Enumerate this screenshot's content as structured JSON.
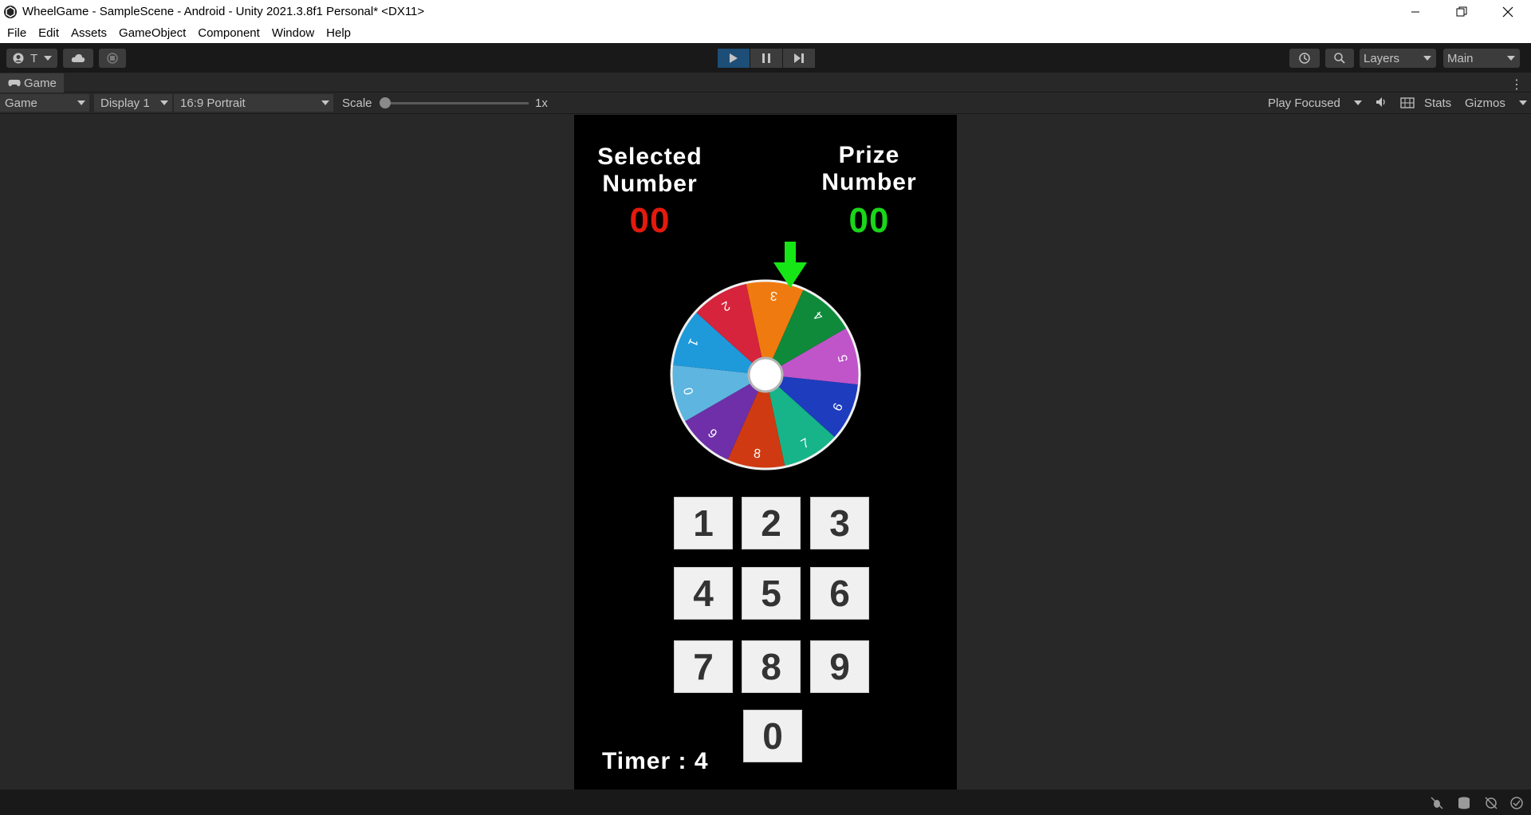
{
  "window": {
    "title": "WheelGame - SampleScene - Android - Unity 2021.3.8f1 Personal* <DX11>",
    "controls": [
      "minimize-icon",
      "restore-icon",
      "close-icon"
    ]
  },
  "menu": {
    "items": [
      "File",
      "Edit",
      "Assets",
      "GameObject",
      "Component",
      "Window",
      "Help"
    ]
  },
  "toolbar": {
    "account_label": "T",
    "layers_label": "Layers",
    "layout_label": "Main"
  },
  "tab": {
    "label": "Game"
  },
  "gamebar": {
    "mode": "Game",
    "display": "Display 1",
    "aspect": "16:9 Portrait",
    "scale_label": "Scale",
    "scale_value": "1x",
    "play_focus": "Play Focused",
    "stats": "Stats",
    "gizmos": "Gizmos"
  },
  "game": {
    "selected_label_line1": "Selected",
    "selected_label_line2": "Number",
    "selected_value": "00",
    "prize_label_line1": "Prize",
    "prize_label_line2": "Number",
    "prize_value": "00",
    "timer": "Timer : 4",
    "keypad": [
      "1",
      "2",
      "3",
      "4",
      "5",
      "6",
      "7",
      "8",
      "9",
      "0"
    ],
    "wheel_segments": [
      {
        "label": "3",
        "color": "#ef7a10"
      },
      {
        "label": "4",
        "color": "#0e8a3a"
      },
      {
        "label": "5",
        "color": "#bf55c8"
      },
      {
        "label": "6",
        "color": "#1e3cbe"
      },
      {
        "label": "7",
        "color": "#16b488"
      },
      {
        "label": "8",
        "color": "#cf3a12"
      },
      {
        "label": "9",
        "color": "#6e2fa8"
      },
      {
        "label": "0",
        "color": "#5db5e0"
      },
      {
        "label": "1",
        "color": "#1e9adb"
      },
      {
        "label": "2",
        "color": "#d6243c"
      }
    ],
    "colors": {
      "selected": "#e31a0c",
      "prize": "#19d619",
      "pointer": "#16e616"
    }
  }
}
